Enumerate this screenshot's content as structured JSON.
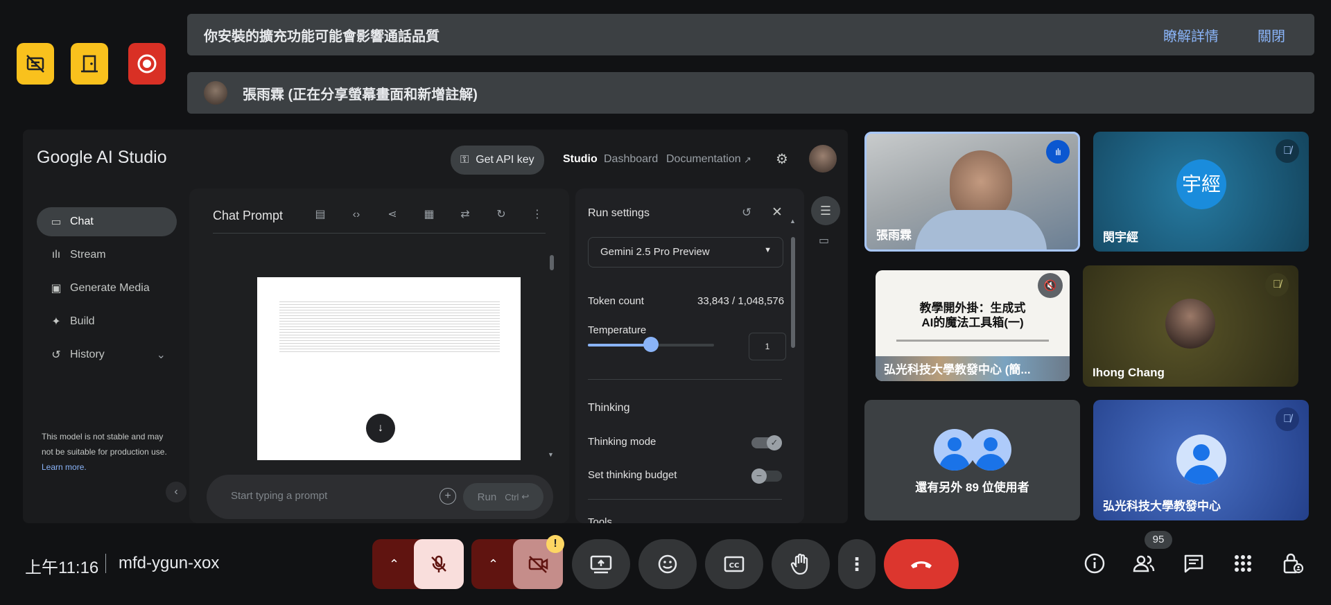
{
  "top_left_buttons": [
    {
      "name": "no-captions",
      "color": "#f9c11d"
    },
    {
      "name": "leave-room",
      "color": "#f9c11d"
    },
    {
      "name": "recording",
      "color": "#d93025"
    }
  ],
  "banners": {
    "extension_warning": "你安裝的擴充功能可能會影響通話品質",
    "learn_more": "瞭解詳情",
    "close": "關閉",
    "presenter": "張雨霖 (正在分享螢幕畫面和新增註解)"
  },
  "studio": {
    "logo": "Google AI Studio",
    "get_api_key": "Get API key",
    "nav": {
      "studio": "Studio",
      "dashboard": "Dashboard",
      "documentation": "Documentation"
    },
    "sidebar": [
      {
        "label": "Chat",
        "icon": "chat-icon",
        "active": true
      },
      {
        "label": "Stream",
        "icon": "stream-icon"
      },
      {
        "label": "Generate Media",
        "icon": "media-icon"
      },
      {
        "label": "Build",
        "icon": "build-icon"
      },
      {
        "label": "History",
        "icon": "history-icon"
      }
    ],
    "disclaimer": "This model is not stable and may not be suitable for production use.",
    "learn_more": "Learn more.",
    "chat_title": "Chat Prompt",
    "prompt_placeholder": "Start typing a prompt",
    "run_label": "Run",
    "run_shortcut": "Ctrl",
    "run_settings": {
      "title": "Run settings",
      "model": "Gemini 2.5 Pro Preview",
      "token_count_label": "Token count",
      "token_count_value": "33,843 / 1,048,576",
      "temperature_label": "Temperature",
      "temperature_value": "1",
      "temperature_fraction": 0.5,
      "thinking_header": "Thinking",
      "thinking_mode": "Thinking mode",
      "thinking_mode_on": true,
      "thinking_budget": "Set thinking budget",
      "thinking_budget_on": false,
      "tools_partial": "Tools"
    }
  },
  "participants": [
    {
      "name": "張雨霖",
      "speaking": true
    },
    {
      "name": "閔宇經",
      "initials": "宇經",
      "muted": true
    },
    {
      "name": "弘光科技大學教發中心 (簡...",
      "slide_title_1": "教學開外掛：生成式",
      "slide_title_2": "AI的魔法工具箱(一)",
      "muted": true
    },
    {
      "name": "Ihong Chang",
      "muted": true
    },
    {
      "others": "還有另外 89 位使用者"
    },
    {
      "name": "弘光科技大學教發中心",
      "muted": true
    }
  ],
  "bottom_bar": {
    "time": "上午11:16",
    "meeting_code": "mfd-ygun-xox",
    "participant_count": "95"
  }
}
